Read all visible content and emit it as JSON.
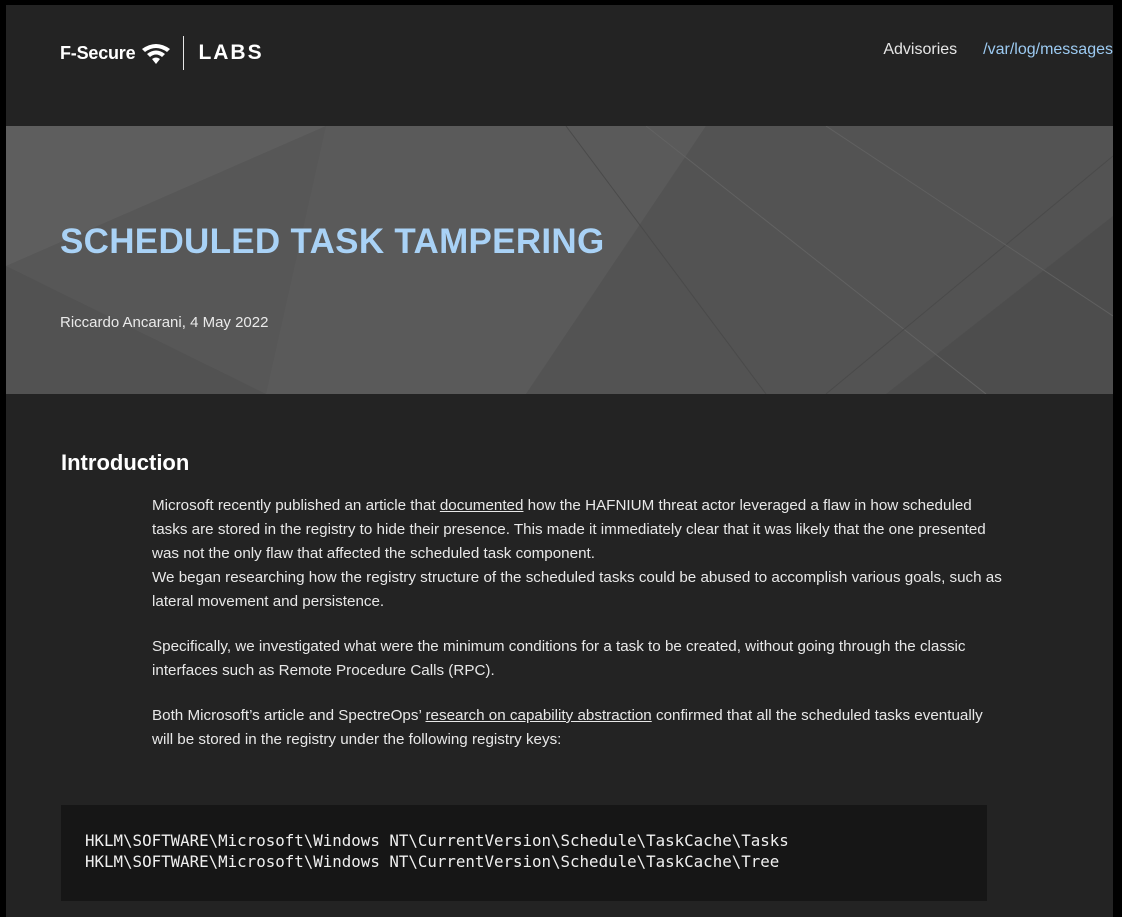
{
  "header": {
    "brand": "F-Secure",
    "labs": "LABS",
    "nav": {
      "advisories": "Advisories",
      "messages": "/var/log/messages"
    }
  },
  "hero": {
    "title": "SCHEDULED TASK TAMPERING",
    "byline": "Riccardo Ancarani, 4 May 2022"
  },
  "article": {
    "heading": "Introduction",
    "p1_before_link": "Microsoft recently published an article that ",
    "p1_link": "documented",
    "p1_after_link": " how the HAFNIUM threat actor leveraged a flaw in how scheduled tasks are stored in the registry to hide their presence. This made it immediately clear that it was likely that the one presented was not the only flaw that affected the scheduled task component.",
    "p1_second": "We began researching how the registry structure of the scheduled tasks could be abused to accomplish various goals, such as lateral movement and persistence.",
    "p2": "Specifically, we investigated what were the minimum conditions for a task to be created, without going through the classic interfaces such as Remote Procedure Calls (RPC).",
    "p3_before_link": "Both Microsoft’s article and SpectreOps’ ",
    "p3_link": "research on capability abstraction",
    "p3_after_link": " confirmed that all the scheduled tasks eventually will be stored in the registry under the following registry keys:",
    "code_lines": [
      "HKLM\\SOFTWARE\\Microsoft\\Windows NT\\CurrentVersion\\Schedule\\TaskCache\\Tasks",
      "HKLM\\SOFTWARE\\Microsoft\\Windows NT\\CurrentVersion\\Schedule\\TaskCache\\Tree"
    ]
  },
  "colors": {
    "page_background": "#232323",
    "hero_background": "#555555",
    "title_accent": "#a9d2f6",
    "nav_link_accent": "#9ccaf1",
    "code_background": "#161616"
  },
  "icons": {
    "logo_mark": "wifi-signal-icon"
  }
}
